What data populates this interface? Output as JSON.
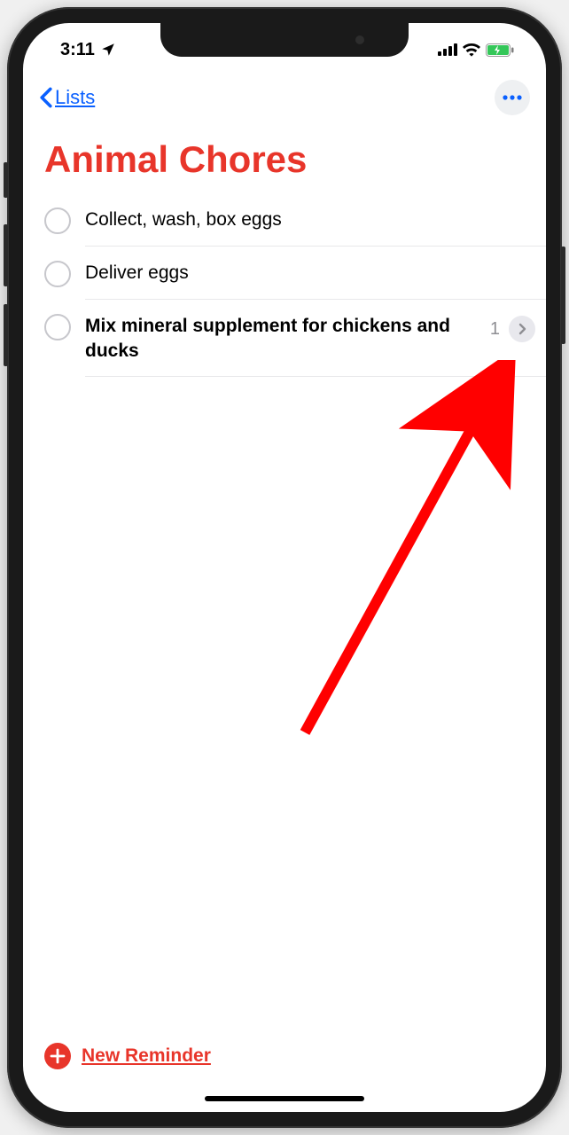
{
  "status": {
    "time": "3:11",
    "location_icon": "location-arrow"
  },
  "nav": {
    "back_label": "Lists",
    "more_icon": "ellipsis"
  },
  "list": {
    "title": "Animal Chores",
    "accent_color": "#e8352a"
  },
  "reminders": [
    {
      "text": "Collect, wash, box eggs",
      "selected": false
    },
    {
      "text": "Deliver eggs",
      "selected": false
    },
    {
      "text": "Mix mineral supplement for chickens and ducks",
      "selected": true,
      "subtask_count": "1"
    }
  ],
  "footer": {
    "new_reminder_label": "New Reminder"
  }
}
